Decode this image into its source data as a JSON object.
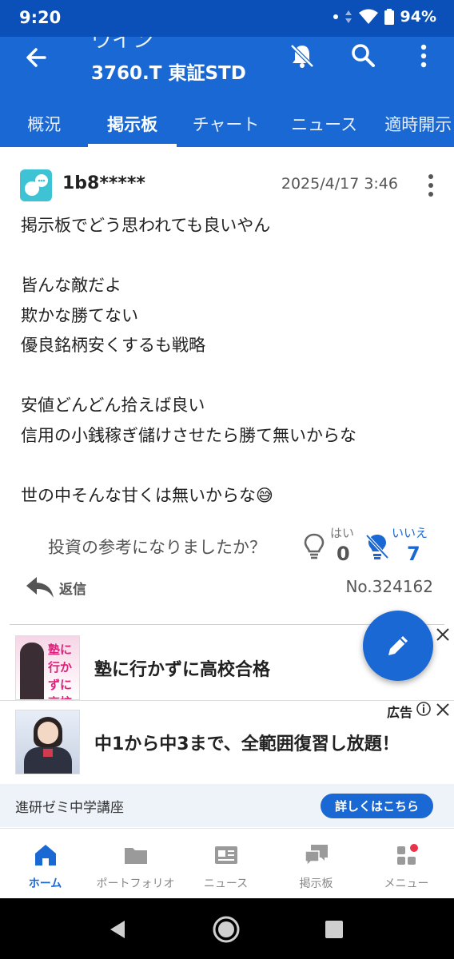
{
  "status_bar": {
    "time": "9:20",
    "battery": "94%"
  },
  "header": {
    "title_partial": "ウイン",
    "title": "3760.T 東証STD",
    "tabs": [
      {
        "label": "概況",
        "active": false
      },
      {
        "label": "掲示板",
        "active": true
      },
      {
        "label": "チャート",
        "active": false
      },
      {
        "label": "ニュース",
        "active": false
      },
      {
        "label": "適時開示",
        "active": false
      }
    ]
  },
  "post": {
    "user": "1b8*****",
    "date": "2025/4/17 3:46",
    "body": "掲示板でどう思われても良いやん\n\n皆んな敵だよ\n欺かな勝てない\n優良銘柄安くするも戦略\n\n安値どんどん拾えば良い\n信用の小銭稼ぎ儲けさせたら勝て無いからな\n\n世の中そんな甘くは無いからな😅",
    "vote_question": "投資の参考になりましたか？",
    "yes_label": "はい",
    "yes_count": "0",
    "no_label": "いいえ",
    "no_count": "7",
    "reply_label": "返信",
    "post_number": "No.324162"
  },
  "ads": {
    "ad1_image_text": "塾に行かずに高校合格",
    "ad1_text": "塾に行かずに高校合格",
    "ad_label": "広告",
    "ad2_text": "中1から中3まで、全範囲復習し放題！",
    "advertiser": "進研ゼミ中学講座",
    "cta": "詳しくはこちら"
  },
  "bottom_nav": [
    {
      "label": "ホーム",
      "icon": "home-icon",
      "active": true
    },
    {
      "label": "ポートフォリオ",
      "icon": "folder-icon",
      "active": false
    },
    {
      "label": "ニュース",
      "icon": "news-icon",
      "active": false
    },
    {
      "label": "掲示板",
      "icon": "chat-icon",
      "active": false
    },
    {
      "label": "メニュー",
      "icon": "menu-grid-icon",
      "active": false
    }
  ],
  "colors": {
    "primary": "#1a68d3",
    "status_bar": "#0b50b8",
    "avatar": "#3ec3d4"
  }
}
